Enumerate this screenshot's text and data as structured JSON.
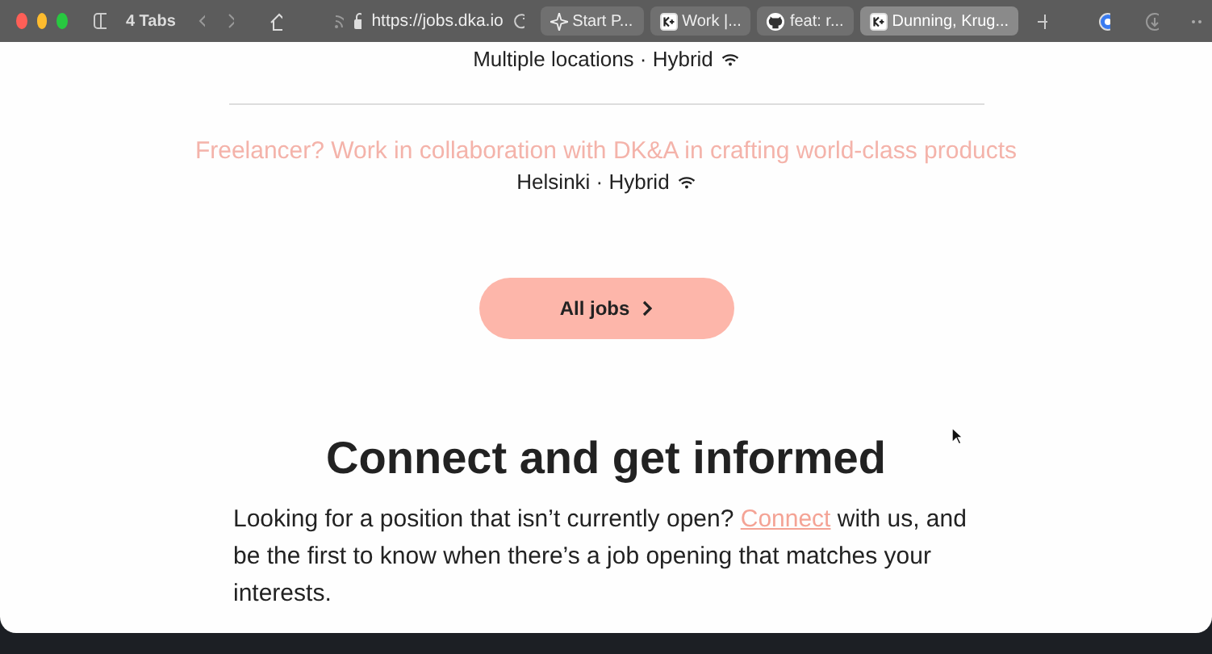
{
  "browser": {
    "tab_count": "4 Tabs",
    "url": "https://jobs.dka.io",
    "tabs": [
      {
        "label": "Start P...",
        "kind": "sparkle",
        "selected": false
      },
      {
        "label": "Work |...",
        "kind": "logo",
        "selected": false
      },
      {
        "label": "feat: r...",
        "kind": "octocat",
        "selected": false
      },
      {
        "label": "Dunning, Krug...",
        "kind": "logo",
        "selected": true
      }
    ]
  },
  "jobs": [
    {
      "meta": "Multiple locations · Hybrid"
    },
    {
      "title": "Freelancer? Work in collaboration with DK&A in crafting world-class products",
      "meta": "Helsinki · Hybrid"
    }
  ],
  "all_jobs_button": "All jobs",
  "connect": {
    "heading": "Connect and get informed",
    "text_before": "Looking for a position that isn’t currently open? ",
    "link": "Connect",
    "text_after": " with us, and be the first to know when there’s a job opening that matches your interests."
  }
}
